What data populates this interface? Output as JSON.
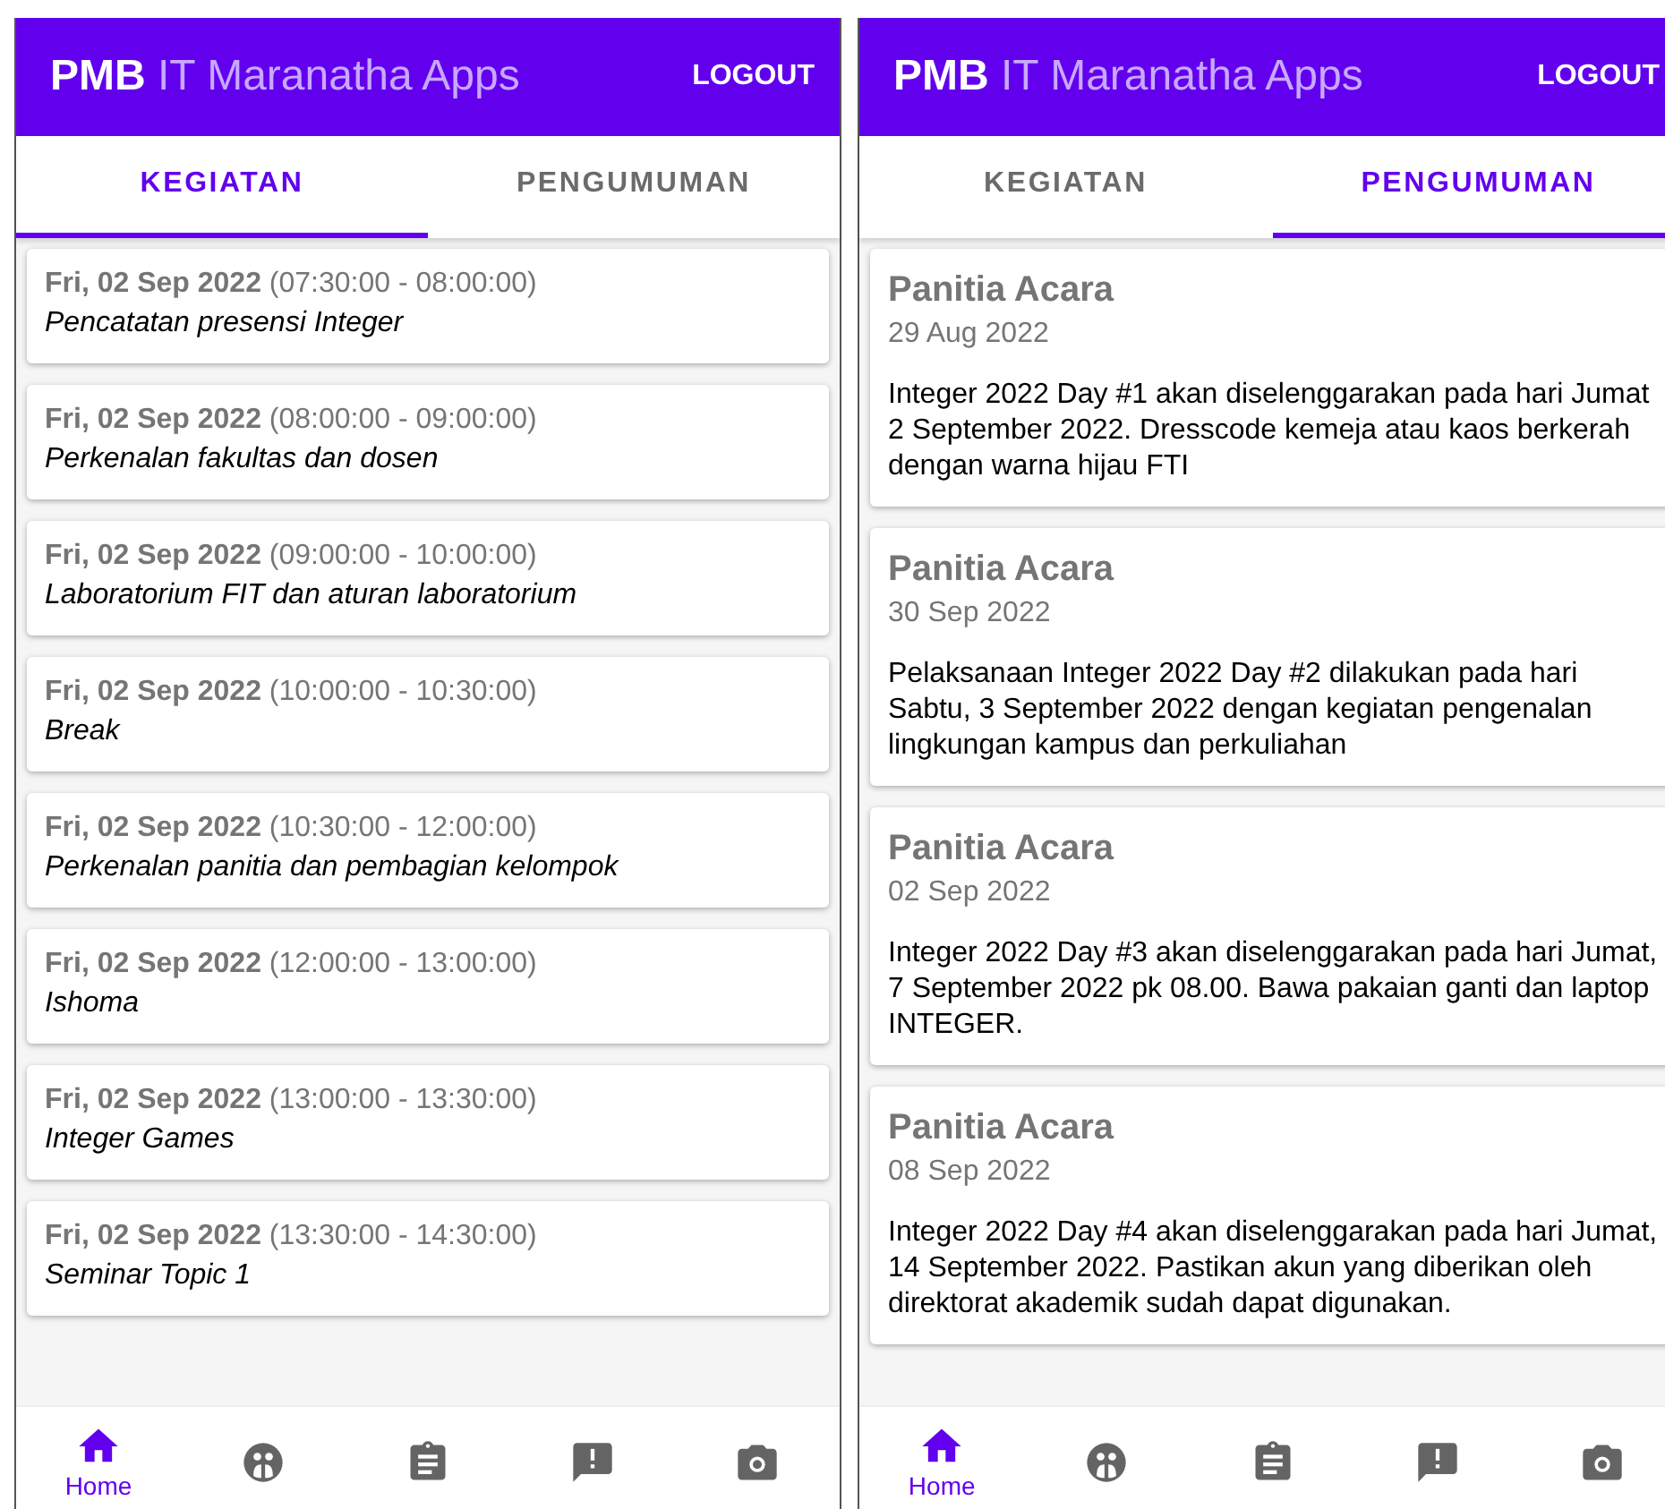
{
  "screens": [
    {
      "app_bar": {
        "title_bold": "PMB",
        "title_rest": "IT Maranatha Apps",
        "action": "LOGOUT"
      },
      "tabs": [
        {
          "label": "KEGIATAN",
          "selected": true
        },
        {
          "label": "PENGUMUMAN",
          "selected": false
        }
      ],
      "events": [
        {
          "when": "**Fri, 02 Sep 2022** (07:30:00 - 08:00:00)",
          "title": "Pencatatan presensi Integer"
        },
        {
          "when": "**Fri, 02 Sep 2022** (08:00:00 - 09:00:00)",
          "title": "Perkenalan fakultas dan dosen"
        },
        {
          "when": "**Fri, 02 Sep 2022** (09:00:00 - 10:00:00)",
          "title": "Laboratorium FIT dan aturan laboratorium"
        },
        {
          "when": "**Fri, 02 Sep 2022** (10:00:00 - 10:30:00)",
          "title": "Break"
        },
        {
          "when": "**Fri, 02 Sep 2022** (10:30:00 - 12:00:00)",
          "title": "Perkenalan panitia dan pembagian kelompok"
        },
        {
          "when": "**Fri, 02 Sep 2022** (12:00:00 - 13:00:00)",
          "title": "Ishoma"
        },
        {
          "when": "**Fri, 02 Sep 2022** (13:00:00 - 13:30:00)",
          "title": "Integer Games"
        },
        {
          "when": "**Fri, 02 Sep 2022** (13:30:00 - 14:30:00)",
          "title": "Seminar Topic 1"
        }
      ],
      "bottom_nav": [
        {
          "kind": "home",
          "label": "Home",
          "selected": true
        },
        {
          "kind": "groups",
          "selected": false
        },
        {
          "kind": "clipboard",
          "selected": false
        },
        {
          "kind": "feedback",
          "selected": false
        },
        {
          "kind": "camera",
          "selected": false
        }
      ]
    },
    {
      "app_bar": {
        "title_bold": "PMB",
        "title_rest": "IT Maranatha Apps",
        "action": "LOGOUT"
      },
      "tabs": [
        {
          "label": "KEGIATAN",
          "selected": false
        },
        {
          "label": "PENGUMUMAN",
          "selected": true
        }
      ],
      "announcements": [
        {
          "author": "Panitia Acara",
          "date": "29 Aug 2022",
          "body": "Integer 2022 Day #1 akan diselenggarakan pada hari Jumat 2 September 2022. Dresscode kemeja atau kaos berkerah dengan warna hijau FTI"
        },
        {
          "author": "Panitia Acara",
          "date": "30 Sep 2022",
          "body": "Pelaksanaan Integer 2022 Day #2 dilakukan pada hari Sabtu, 3 September 2022 dengan kegiatan pengenalan lingkungan kampus dan perkuliahan"
        },
        {
          "author": "Panitia Acara",
          "date": "02 Sep 2022",
          "body": "Integer 2022 Day #3 akan diselenggarakan pada hari Jumat, 7 September 2022 pk 08.00. Bawa pakaian ganti dan laptop INTEGER."
        },
        {
          "author": "Panitia Acara",
          "date": "08 Sep 2022",
          "body": "Integer 2022 Day #4 akan diselenggarakan pada hari Jumat, 14 September 2022. Pastikan akun yang diberikan oleh direktorat akademik sudah dapat digunakan."
        }
      ],
      "bottom_nav": [
        {
          "kind": "home",
          "label": "Home",
          "selected": true
        },
        {
          "kind": "groups",
          "selected": false
        },
        {
          "kind": "clipboard",
          "selected": false
        },
        {
          "kind": "feedback",
          "selected": false
        },
        {
          "kind": "camera",
          "selected": false
        }
      ]
    }
  ]
}
